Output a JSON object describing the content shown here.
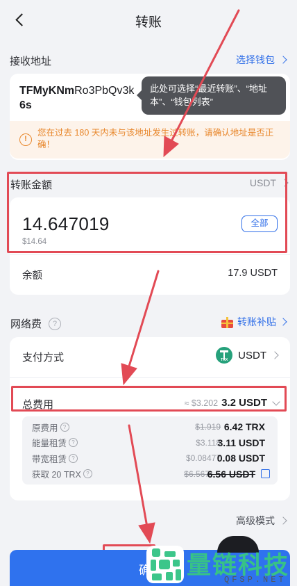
{
  "header": {
    "title": "转账"
  },
  "recipient": {
    "label": "接收地址",
    "select_wallet": "选择钱包",
    "address_line1_bold": "TFMyKNm",
    "address_line1_rest": "Ro3PbQv3k",
    "address_line2": "6s",
    "tooltip": "此处可选择“最近转账”、“地址本”、“钱包列表”",
    "warning": "您在过去 180 天内未与该地址发生过转账，请确认地址是否正确！"
  },
  "amount": {
    "label": "转账金额",
    "token": "USDT",
    "value": "14.647019",
    "fiat": "$14.64",
    "all_button": "全部",
    "balance_label": "余额",
    "balance_value": "17.9 USDT"
  },
  "network_fee": {
    "label": "网络费",
    "subsidy_label": "转账补贴",
    "payment_label": "支付方式",
    "payment_token": "USDT",
    "trx_logo_text": "TRX",
    "total_label": "总费用",
    "total_approx": "≈ $3.202",
    "total_value": "3.2 USDT",
    "rows": [
      {
        "label": "原费用",
        "old": "$1.919",
        "new": "6.42 TRX",
        "has_q": true,
        "old_strike": true,
        "checkbox": false
      },
      {
        "label": "能量租赁",
        "old": "$3.118",
        "new": "3.11 USDT",
        "has_q": true,
        "old_strike": false,
        "checkbox": false
      },
      {
        "label": "带宽租赁",
        "old": "$0.08477",
        "new": "0.08 USDT",
        "has_q": true,
        "old_strike": false,
        "checkbox": false
      },
      {
        "label": "获取 20 TRX",
        "old": "$6.567",
        "new": "6.56 USDT",
        "has_q": true,
        "old_strike": true,
        "checkbox": true
      }
    ]
  },
  "advanced_mode": "高级模式",
  "confirm_button": "确",
  "watermark": {
    "name": "量链科技",
    "domain": "QFSP.NET"
  },
  "colors": {
    "accent": "#2f6ee8",
    "annotation_red": "#e24a55",
    "warning_orange": "#e8872c",
    "usdt_green": "#26a17b"
  }
}
